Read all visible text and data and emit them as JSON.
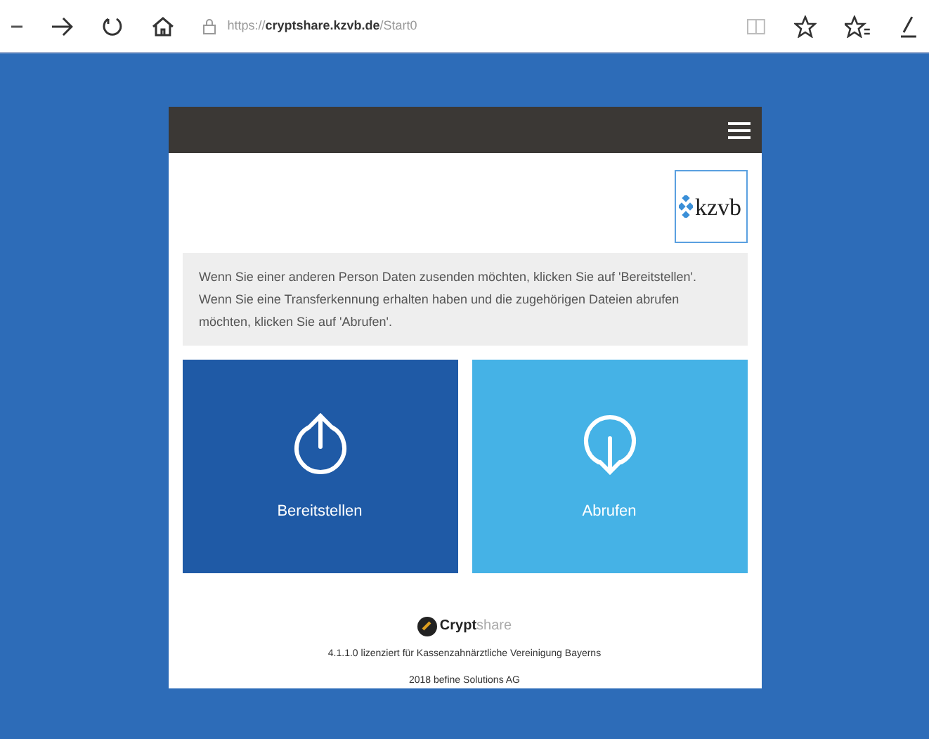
{
  "browser": {
    "url_prefix": "https://",
    "url_host": "cryptshare.kzvb.de",
    "url_path": "/Start0"
  },
  "logo": {
    "text": "kzvb"
  },
  "info": "Wenn Sie einer anderen Person Daten zusenden möchten, klicken Sie auf 'Bereitstellen'. Wenn Sie eine Transferkennung erhalten haben und die zugehörigen Dateien abrufen möchten, klicken Sie auf 'Abrufen'.",
  "tiles": [
    {
      "kind": "upload",
      "label": "Bereitstellen"
    },
    {
      "kind": "download",
      "label": "Abrufen"
    }
  ],
  "footer": {
    "brand_bold": "Crypt",
    "brand_light": "share",
    "license": "4.1.1.0 lizenziert für Kassenzahnärztliche Vereinigung Bayerns",
    "copyright": "2018 befine Solutions AG"
  }
}
